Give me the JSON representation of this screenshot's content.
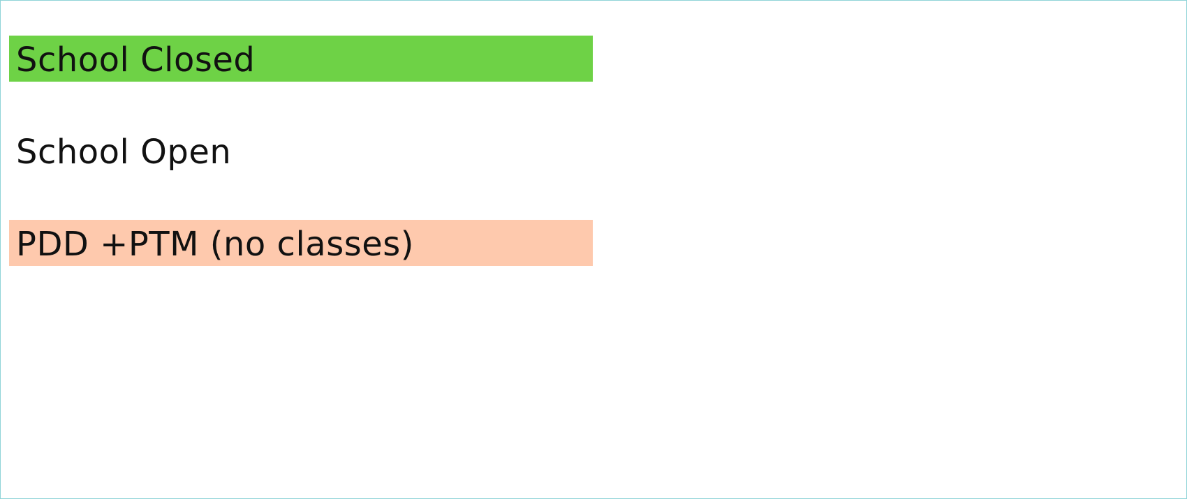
{
  "legend": {
    "items": [
      {
        "label": "School Closed",
        "color": "#6ed246"
      },
      {
        "label": "School Open",
        "color": "#ffffff"
      },
      {
        "label": "PDD +PTM (no classes)",
        "color": "#fec9ad"
      }
    ]
  },
  "frame": {
    "border_color": "#8fd3d8",
    "background_color": "#ffffff"
  }
}
